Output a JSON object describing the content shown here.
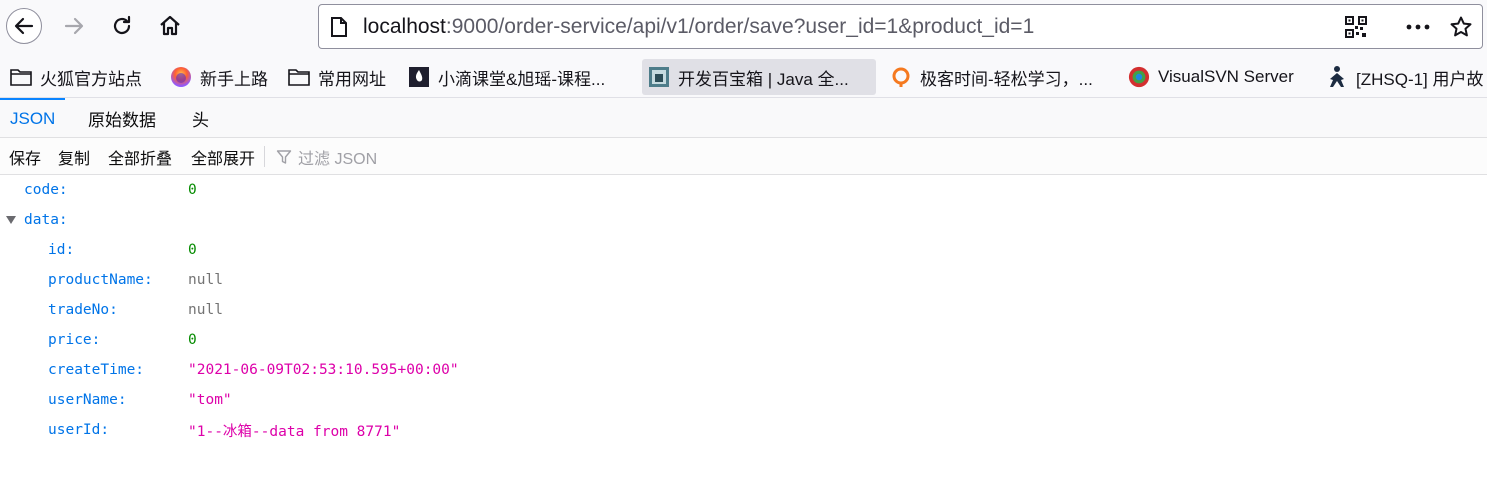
{
  "browser": {
    "url_host": "localhost",
    "url_rest": ":9000/order-service/api/v1/order/save?user_id=1&product_id=1",
    "bookmarks": [
      {
        "label": "火狐官方站点",
        "icon": "folder-icon"
      },
      {
        "label": "新手上路",
        "icon": "firefox-icon"
      },
      {
        "label": "常用网址",
        "icon": "folder-icon"
      },
      {
        "label": "小滴课堂&旭瑶-课程...",
        "icon": "site-favicon"
      },
      {
        "label": "开发百宝箱 | Java 全...",
        "icon": "site-favicon"
      },
      {
        "label": "极客时间-轻松学习，...",
        "icon": "geektime-icon"
      },
      {
        "label": "VisualSVN Server",
        "icon": "visualsvn-icon"
      },
      {
        "label": "[ZHSQ-1] 用户故",
        "icon": "jira-icon"
      }
    ],
    "colors": {
      "accent": "#0a84ff",
      "key": "#0074e8",
      "number": "#058b00",
      "string": "#dd00a9",
      "null": "#737373"
    }
  },
  "viewer": {
    "tabs": [
      {
        "label": "JSON",
        "selected": true
      },
      {
        "label": "原始数据",
        "selected": false
      },
      {
        "label": "头",
        "selected": false
      }
    ],
    "toolbar": {
      "save": "保存",
      "copy": "复制",
      "collapse_all": "全部折叠",
      "expand_all": "全部展开",
      "filter_placeholder": "过滤 JSON"
    }
  },
  "json": {
    "code": {
      "key": "code:",
      "value": "0"
    },
    "data": {
      "key": "data:"
    },
    "fields": [
      {
        "key": "id:",
        "value": "0",
        "type": "num"
      },
      {
        "key": "productName:",
        "value": "null",
        "type": "null"
      },
      {
        "key": "tradeNo:",
        "value": "null",
        "type": "null"
      },
      {
        "key": "price:",
        "value": "0",
        "type": "num"
      },
      {
        "key": "createTime:",
        "value": "\"2021-06-09T02:53:10.595+00:00\"",
        "type": "str"
      },
      {
        "key": "userName:",
        "value": "\"tom\"",
        "type": "str"
      },
      {
        "key": "userId:",
        "value": "\"1--冰箱--data from 8771\"",
        "type": "str"
      }
    ]
  }
}
